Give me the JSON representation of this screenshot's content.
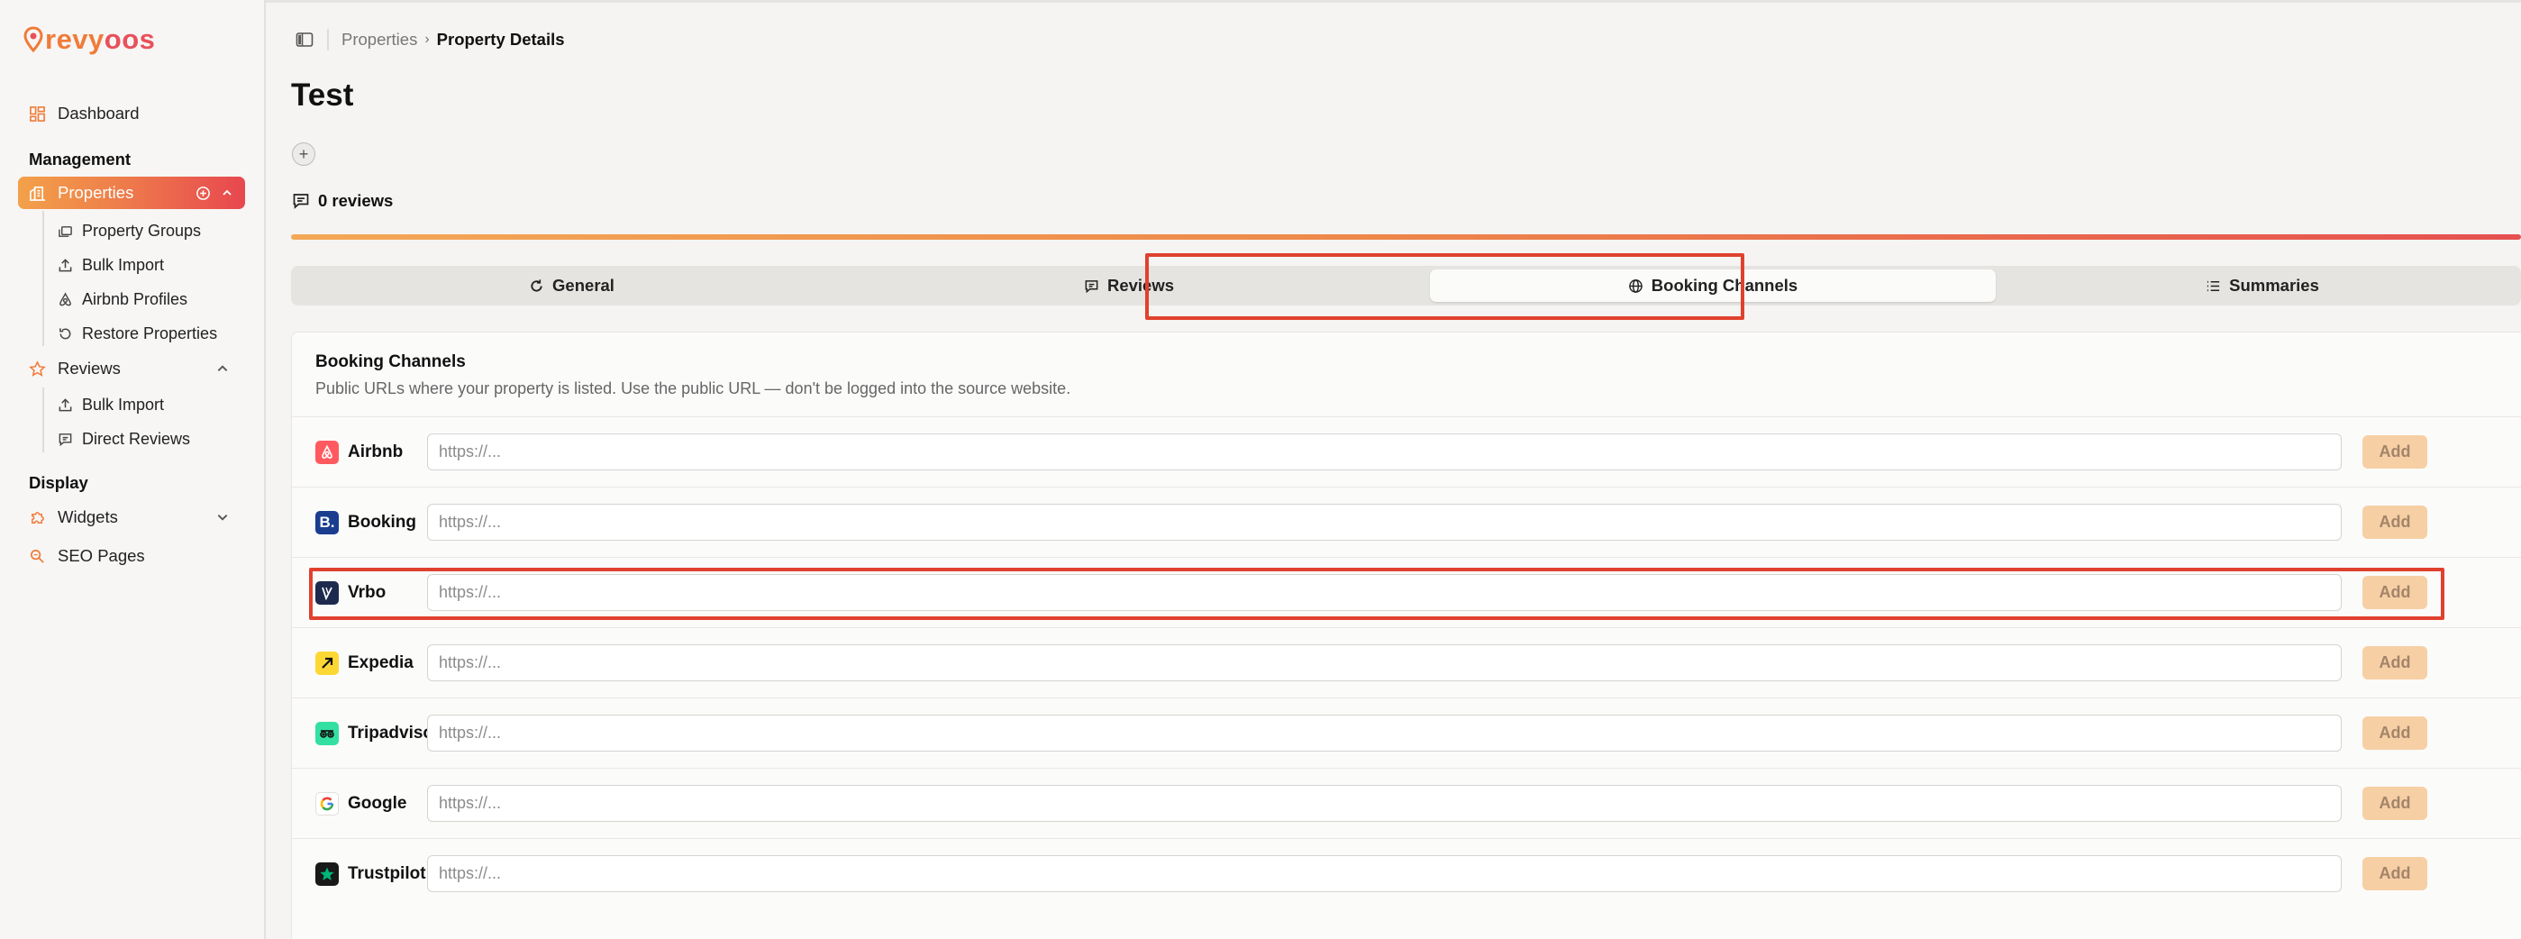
{
  "app": {
    "logo_main": "revy",
    "logo_accent": "oos",
    "brand_colors": {
      "orange": "#f07b39",
      "red": "#e8515a",
      "highlight": "#e0412e"
    }
  },
  "sidebar": {
    "dashboard": "Dashboard",
    "management_label": "Management",
    "properties": "Properties",
    "properties_children": [
      "Property Groups",
      "Bulk Import",
      "Airbnb Profiles",
      "Restore Properties"
    ],
    "reviews": "Reviews",
    "reviews_children": [
      "Bulk Import",
      "Direct Reviews"
    ],
    "display_label": "Display",
    "widgets": "Widgets",
    "seo_pages": "SEO Pages"
  },
  "breadcrumb": {
    "parent": "Properties",
    "current": "Property Details"
  },
  "page": {
    "title": "Test",
    "add_symbol": "+",
    "reviews_count": "0 reviews"
  },
  "tabs": [
    {
      "label": "General",
      "icon": "refresh-icon",
      "active": false
    },
    {
      "label": "Reviews",
      "icon": "message-square-icon",
      "active": false
    },
    {
      "label": "Booking Channels",
      "icon": "globe-icon",
      "active": true
    },
    {
      "label": "Summaries",
      "icon": "list-icon",
      "active": false
    }
  ],
  "booking": {
    "title": "Booking Channels",
    "description": "Public URLs where your property is listed. Use the public URL — don't be logged into the source website.",
    "placeholder": "https://...",
    "add_label": "Add",
    "channels": [
      {
        "name": "Airbnb",
        "value": ""
      },
      {
        "name": "Booking",
        "value": ""
      },
      {
        "name": "Vrbo",
        "value": ""
      },
      {
        "name": "Expedia",
        "value": ""
      },
      {
        "name": "Tripadvisor",
        "value": ""
      },
      {
        "name": "Google",
        "value": ""
      },
      {
        "name": "Trustpilot",
        "value": ""
      }
    ]
  }
}
